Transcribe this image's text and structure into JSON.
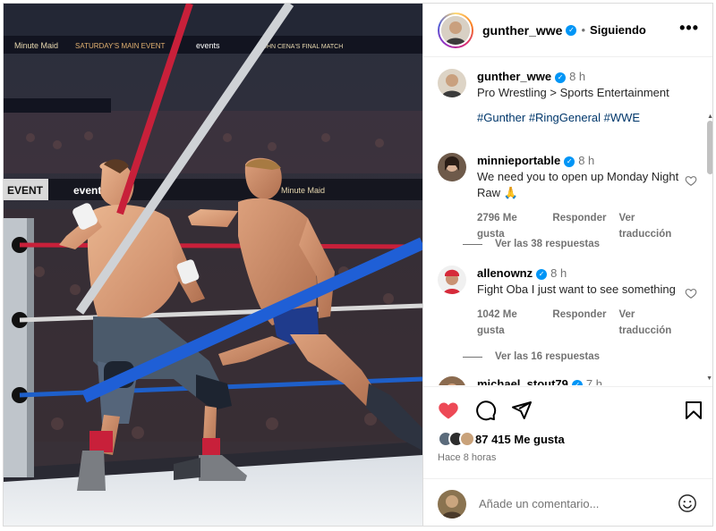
{
  "post": {
    "author": "gunther_wwe",
    "follow_status": "Siguiendo",
    "more_glyph": "•••"
  },
  "caption": {
    "username": "gunther_wwe",
    "time": "8 h",
    "text": "Pro Wrestling > Sports Entertainment",
    "hashtags": "#Gunther #RingGeneral #WWE"
  },
  "comments": [
    {
      "username": "minnieportable",
      "time": "8 h",
      "text": "We need you to open up Monday Night Raw 🙏",
      "likes": "2796 Me gusta",
      "reply": "Responder",
      "translate": "Ver traducción",
      "view_replies": "Ver las 38 respuestas"
    },
    {
      "username": "allenownz",
      "time": "8 h",
      "text": "Fight Oba I just want to see something",
      "likes": "1042 Me gusta",
      "reply": "Responder",
      "translate": "Ver traducción",
      "view_replies": "Ver las 16 respuestas"
    },
    {
      "username": "michael_stout79",
      "time": "7 h"
    }
  ],
  "footer": {
    "likes_count": "87 415 Me gusta",
    "posted_ago": "Hace 8 horas",
    "comment_placeholder": "Añade un comentario..."
  },
  "photo": {
    "banner_texts": [
      "Minute Maid",
      "EVENT",
      "events",
      "SATURDAY'S MAIN EVENT",
      "JOHN CENA'S FINAL MATCH",
      "Minute Maid"
    ]
  },
  "colors": {
    "liked_heart": "#ed4956",
    "verified": "#0095f6",
    "hashtag": "#00376b",
    "muted": "#737373"
  },
  "icons": [
    "verified-badge-icon",
    "more-options-icon",
    "heart-icon",
    "comment-icon",
    "share-icon",
    "bookmark-icon",
    "emoji-icon"
  ]
}
